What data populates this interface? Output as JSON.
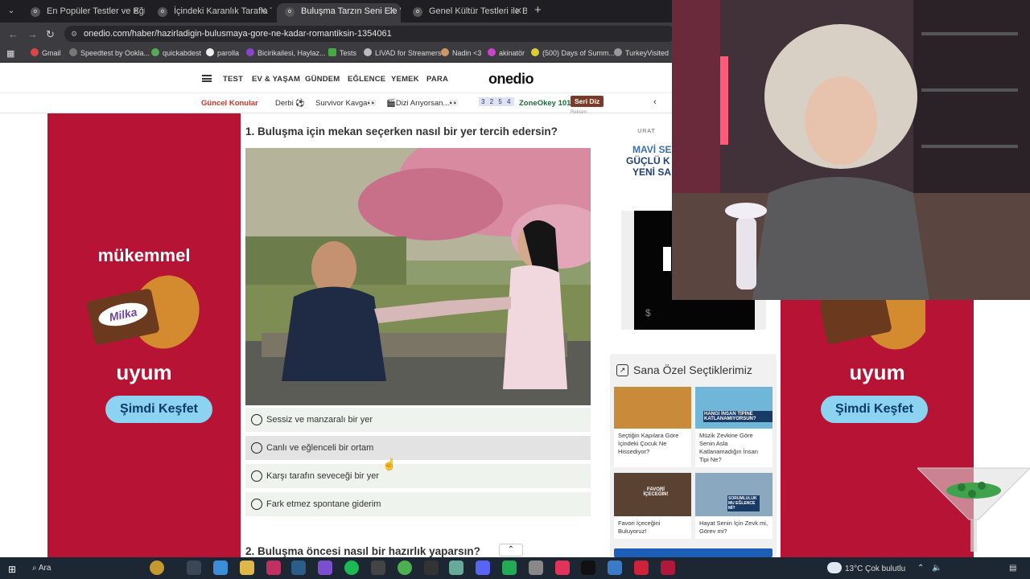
{
  "browser": {
    "tabs": [
      {
        "label": "En Popüler Testler ve Eğlenceli",
        "active": false
      },
      {
        "label": "İçindeki Karanlık Tarafla Tanışm",
        "active": false
      },
      {
        "label": "Buluşma Tarzın Seni Ele Veriyor",
        "active": true
      },
      {
        "label": "Genel Kültür Testleri ile Bilgini",
        "active": false
      }
    ],
    "url": "onedio.com/haber/hazirladigin-bulusmaya-gore-ne-kadar-romantiksin-1354061",
    "bookmarks": [
      "Gmail",
      "Speedtest by Ookla...",
      "quickabdest",
      "parolla",
      "Bicirikailesi, Haylaz...",
      "Tests",
      "LIVAD for Streamers",
      "Nadin <3",
      "akinatör",
      "(500) Days of Summ...",
      "TurkeyVisited"
    ]
  },
  "site": {
    "nav": [
      "TEST",
      "EV & YAŞAM",
      "GÜNDEM",
      "EĞLENCE",
      "YEMEK",
      "PARA"
    ],
    "logo": "onedio",
    "subnav": {
      "label": "Güncel Konular",
      "items": [
        "Derbi ⚽",
        "Survivor Kavga👀",
        "🎬Dizi Arıyorsan...👀"
      ],
      "tiles": "3 2 5 4",
      "zone": "ZoneOkey 101",
      "badge": "Seri Diz"
    }
  },
  "quiz": {
    "q1": "1. Buluşma için mekan seçerken nasıl bir yer tercih edersin?",
    "options": [
      "Sessiz ve manzaralı bir yer",
      "Canlı ve eğlenceli bir ortam",
      "Karşı tarafın seveceği bir yer",
      "Fark etmez spontane giderim"
    ],
    "q2": "2. Buluşma öncesi nasıl bir hazırlık yaparsın?",
    "reklam": "Reklam"
  },
  "ads": {
    "headline": "mükemmel",
    "brand": "Milka",
    "tagline": "uyum",
    "button": "Şimdi Keşfet",
    "urad": [
      "URAT",
      "MAVİ SE",
      "GÜÇLÜ K",
      "YENİ SA"
    ]
  },
  "recommendations": {
    "title": "Sana Özel Seçtiklerimiz",
    "cards": [
      {
        "caption": "Seçtiğin Kapılara Göre İçindeki Çocuk Ne Hissediyor?",
        "img_text": "",
        "color": "#c98a3a"
      },
      {
        "caption": "Müzik Zevkine Göre Senin Asla Katlanamadığın İnsan Tipi Ne?",
        "img_text": "HANGİ İNSAN TİPİNE KATLANAMIYORSUN?",
        "color": "#6fb6d8"
      },
      {
        "caption": "Favori İçeceğini Buluyoruz!",
        "img_text": "FAVORİ İÇECEĞİN!",
        "color": "#5a4232"
      },
      {
        "caption": "Hayat Senin İçin Zevk mi, Görev mi?",
        "img_text": "SORUMLULUK MU EĞLENCE Mİ?",
        "color": "#8aa8c0"
      }
    ]
  },
  "taskbar": {
    "search": "Ara",
    "weather": "13°C  Çok bulutlu"
  }
}
